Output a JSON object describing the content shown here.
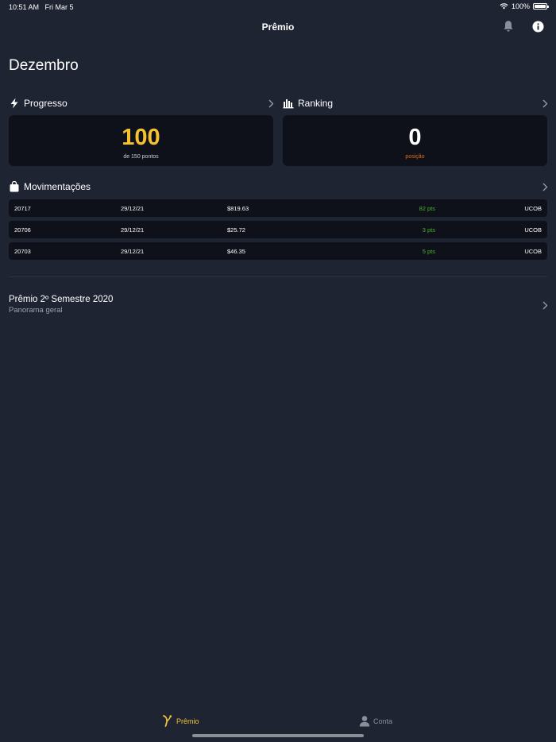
{
  "status_bar": {
    "time": "10:51 AM",
    "date": "Fri Mar 5",
    "battery": "100%",
    "battery_level": 1.0
  },
  "nav": {
    "title": "Prêmio",
    "bell_icon": "bell-icon",
    "info_icon": "info-icon"
  },
  "month": "Dezembro",
  "progresso": {
    "label": "Progresso",
    "value": "100",
    "subtitle": "de 150 pontos",
    "value_color": "#f5c22f"
  },
  "ranking": {
    "label": "Ranking",
    "value": "0",
    "subtitle": "posição",
    "subtitle_color": "#e06b16"
  },
  "movimentacoes": {
    "label": "Movimentações",
    "rows": [
      {
        "id": "20717",
        "date": "29/12/21",
        "amount": "$819.63",
        "points": "82 pts",
        "code": "UCOB"
      },
      {
        "id": "20706",
        "date": "29/12/21",
        "amount": "$25.72",
        "points": "3 pts",
        "code": "UCOB"
      },
      {
        "id": "20703",
        "date": "29/12/21",
        "amount": "$46.35",
        "points": "5 pts",
        "code": "UCOB"
      }
    ]
  },
  "season": {
    "title": "Prêmio 2º Semestre 2020",
    "subtitle": "Panorama geral"
  },
  "tabs": [
    {
      "label": "Prêmio",
      "icon": "premio-logo-icon",
      "active": true
    },
    {
      "label": "Conta",
      "icon": "person-icon",
      "active": false
    }
  ],
  "colors": {
    "background": "#1f2432",
    "card": "#0e1119",
    "accent": "#f0c33b",
    "points_green": "#46b22a"
  }
}
